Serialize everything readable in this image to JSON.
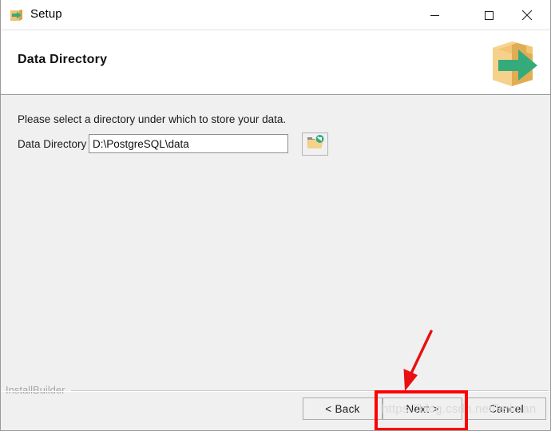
{
  "window": {
    "title": "Setup",
    "app_icon": "box-arrow-icon",
    "controls": {
      "minimize": "minimize-icon",
      "maximize": "maximize-icon",
      "close": "close-icon"
    }
  },
  "header": {
    "title": "Data Directory",
    "logo": "installer-box-arrow-logo"
  },
  "main": {
    "instruction": "Please select a directory under which to store your data.",
    "field": {
      "label": "Data Directory",
      "value": "D:\\PostgreSQL\\data",
      "placeholder": "",
      "browse_icon": "folder-browse-icon"
    }
  },
  "footer": {
    "brand": "InstallBuilder",
    "buttons": {
      "back": "< Back",
      "next": "Next >",
      "cancel": "Cancel"
    }
  },
  "annotations": {
    "watermark": "https://blog.csdn.net/leriman",
    "highlight_target": "Next >",
    "arrow": "red-pointer-arrow"
  },
  "colors": {
    "accent_green": "#35ab7c",
    "box_tan": "#f0c070",
    "highlight_red": "#ff0000",
    "content_bg": "#f0f0f0",
    "header_bg": "#ffffff"
  }
}
